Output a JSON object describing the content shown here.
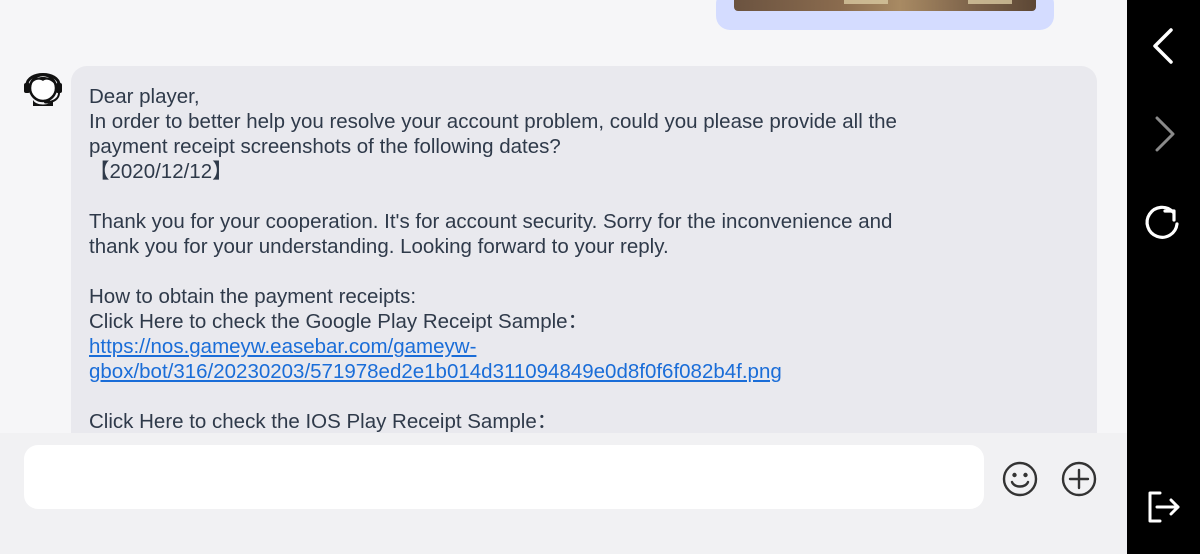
{
  "chat": {
    "agent_message": {
      "lines": [
        "Dear player,",
        "In order to better help you resolve your account problem, could you please provide all the",
        "payment receipt screenshots of the following dates?",
        "【2020/12/12】",
        "",
        "Thank you for your cooperation. It's for account security. Sorry for the inconvenience and",
        "thank you for your understanding. Looking forward to your reply.",
        "",
        "How to obtain the payment receipts:",
        "Click Here to check the Google Play Receipt Sample："
      ],
      "link_lines": [
        "https://nos.gameyw.easebar.com/gameyw-",
        "gbox/bot/316/20230203/571978ed2e1b014d311094849e0d8f0f6f082b4f.png"
      ],
      "after_link_lines": [
        "",
        "Click Here to check the IOS Play Receipt Sample："
      ]
    },
    "avatar_icon": "customer-service-headset-icon"
  },
  "input_bar": {
    "placeholder": "",
    "value": "",
    "emoji_icon": "smiley-icon",
    "add_icon": "plus-circle-icon"
  },
  "nav_rail": {
    "icons": [
      "back-chevron-icon",
      "forward-chevron-icon",
      "refresh-icon",
      "exit-icon"
    ]
  },
  "colors": {
    "chat_background": "#f6f6f8",
    "agent_bubble": "#e9e9ee",
    "sent_bubble": "#d4dcff",
    "link": "#1a6dd8",
    "rail": "#000000"
  }
}
